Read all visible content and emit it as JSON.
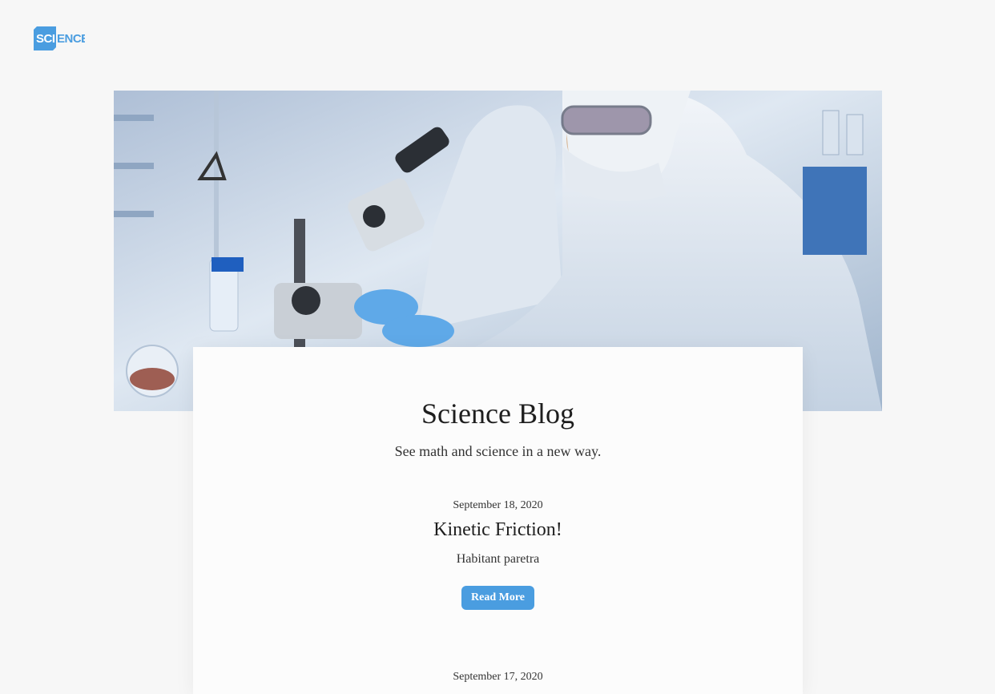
{
  "brand": {
    "logo_text": "SCIENCE",
    "logo_color": "#4a9de0"
  },
  "hero": {
    "image_alt": "laboratory-scientist-microscope-photo"
  },
  "blog": {
    "title": "Science Blog",
    "subtitle": "See math and science in a new way."
  },
  "posts": [
    {
      "date": "September 18, 2020",
      "title": "Kinetic Friction!",
      "excerpt": "Habitant paretra",
      "button_label": "Read More"
    },
    {
      "date": "September 17, 2020"
    }
  ],
  "colors": {
    "page_background": "#f7f7f7",
    "card_background": "#fcfcfc",
    "button": "#4a9de0"
  }
}
